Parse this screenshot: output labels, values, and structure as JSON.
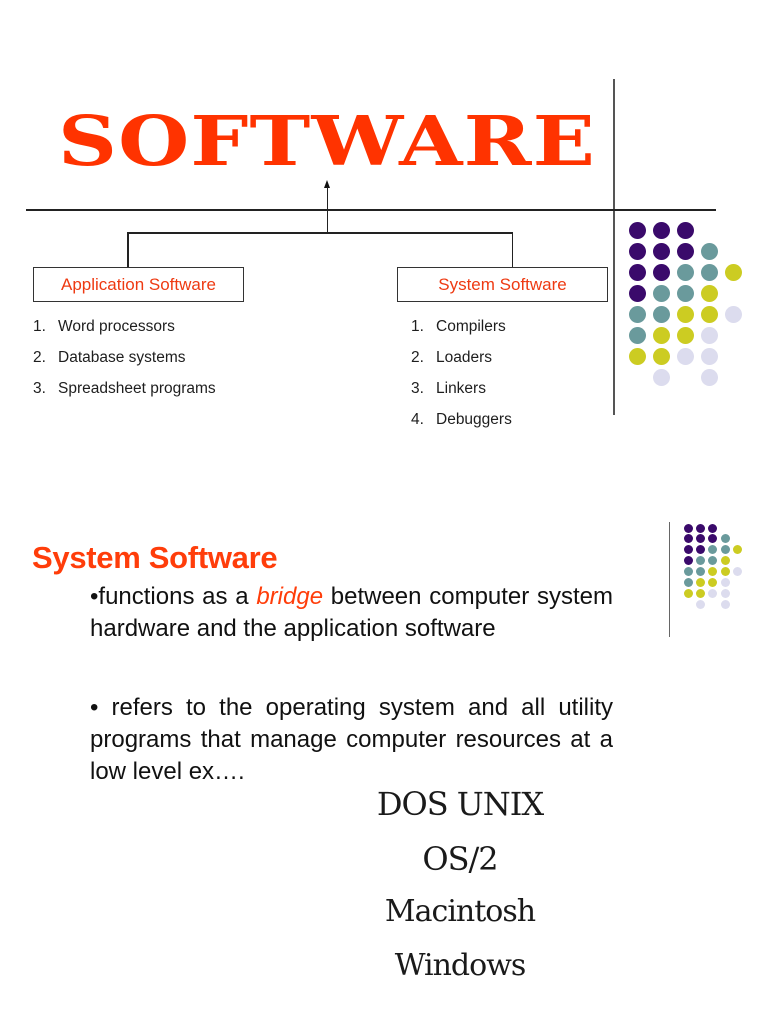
{
  "slide1": {
    "title": "SOFTWARE",
    "branches": [
      {
        "label": "Application Software",
        "items": [
          {
            "num": "1.",
            "text": "Word processors"
          },
          {
            "num": "2.",
            "text": "Database systems"
          },
          {
            "num": "3.",
            "text": "Spreadsheet programs"
          }
        ]
      },
      {
        "label": "System Software",
        "items": [
          {
            "num": "1.",
            "text": "Compilers"
          },
          {
            "num": "2.",
            "text": "Loaders"
          },
          {
            "num": "3.",
            "text": "Linkers"
          },
          {
            "num": "4.",
            "text": "Debuggers"
          }
        ]
      }
    ]
  },
  "slide2": {
    "title": "System Software",
    "bullet1": {
      "prefix": "•functions as a ",
      "emphasis": "bridge",
      "suffix": " between computer system hardware and the application software"
    },
    "bullet2": "• refers to the operating system and all utility programs that manage computer resources at a low level ex….",
    "examples": [
      "DOS UNIX",
      "OS/2",
      "Macintosh",
      "Windows"
    ]
  },
  "decoration": {
    "colors": {
      "P": "#3a0a6b",
      "T": "#6a9a9c",
      "Y": "#cccc22",
      "L": "#dcdcee",
      "title": "#ff3300",
      "heading": "#ff3d0a"
    },
    "dot_pattern": [
      "PPP..",
      "PPPT.",
      "PPTTY",
      "PTTY.",
      "TTYYL",
      "TYYL.",
      "YYLL.",
      ".L.L."
    ]
  }
}
